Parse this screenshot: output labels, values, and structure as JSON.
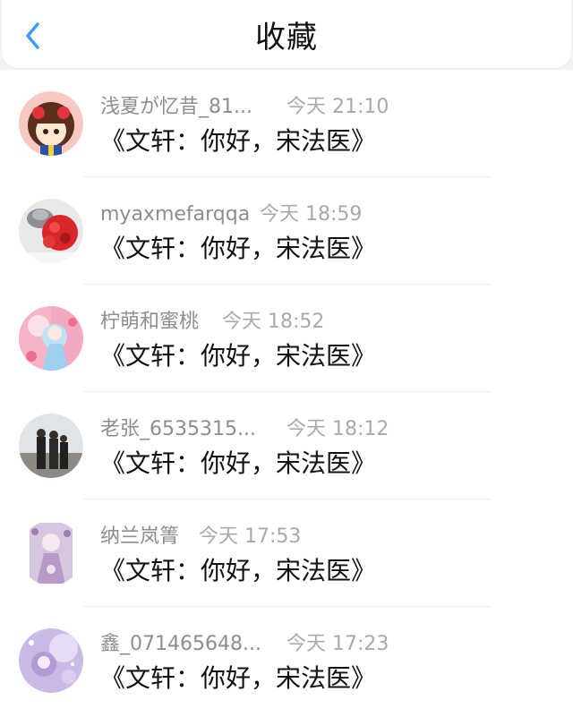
{
  "header": {
    "title": "收藏",
    "back_icon": "chevron-left-icon"
  },
  "colors": {
    "accent": "#3d9af5",
    "name": "#8d8d8d",
    "time": "#a9a9a9",
    "text": "#111111"
  },
  "items": [
    {
      "name": "浅夏が忆昔_81...",
      "time": "今天 21:10",
      "book": "《文轩：你好，宋法医》"
    },
    {
      "name": "myaxmefarqqa",
      "time": "今天 18:59",
      "book": "《文轩：你好，宋法医》"
    },
    {
      "name": "柠萌和蜜桃",
      "time": "今天 18:52",
      "book": "《文轩：你好，宋法医》"
    },
    {
      "name": "老张_6535315...",
      "time": "今天 18:12",
      "book": "《文轩：你好，宋法医》"
    },
    {
      "name": "纳兰岚箐",
      "time": "今天 17:53",
      "book": "《文轩：你好，宋法医》"
    },
    {
      "name": "鑫_071465648...",
      "time": "今天 17:23",
      "book": "《文轩：你好，宋法医》"
    }
  ]
}
